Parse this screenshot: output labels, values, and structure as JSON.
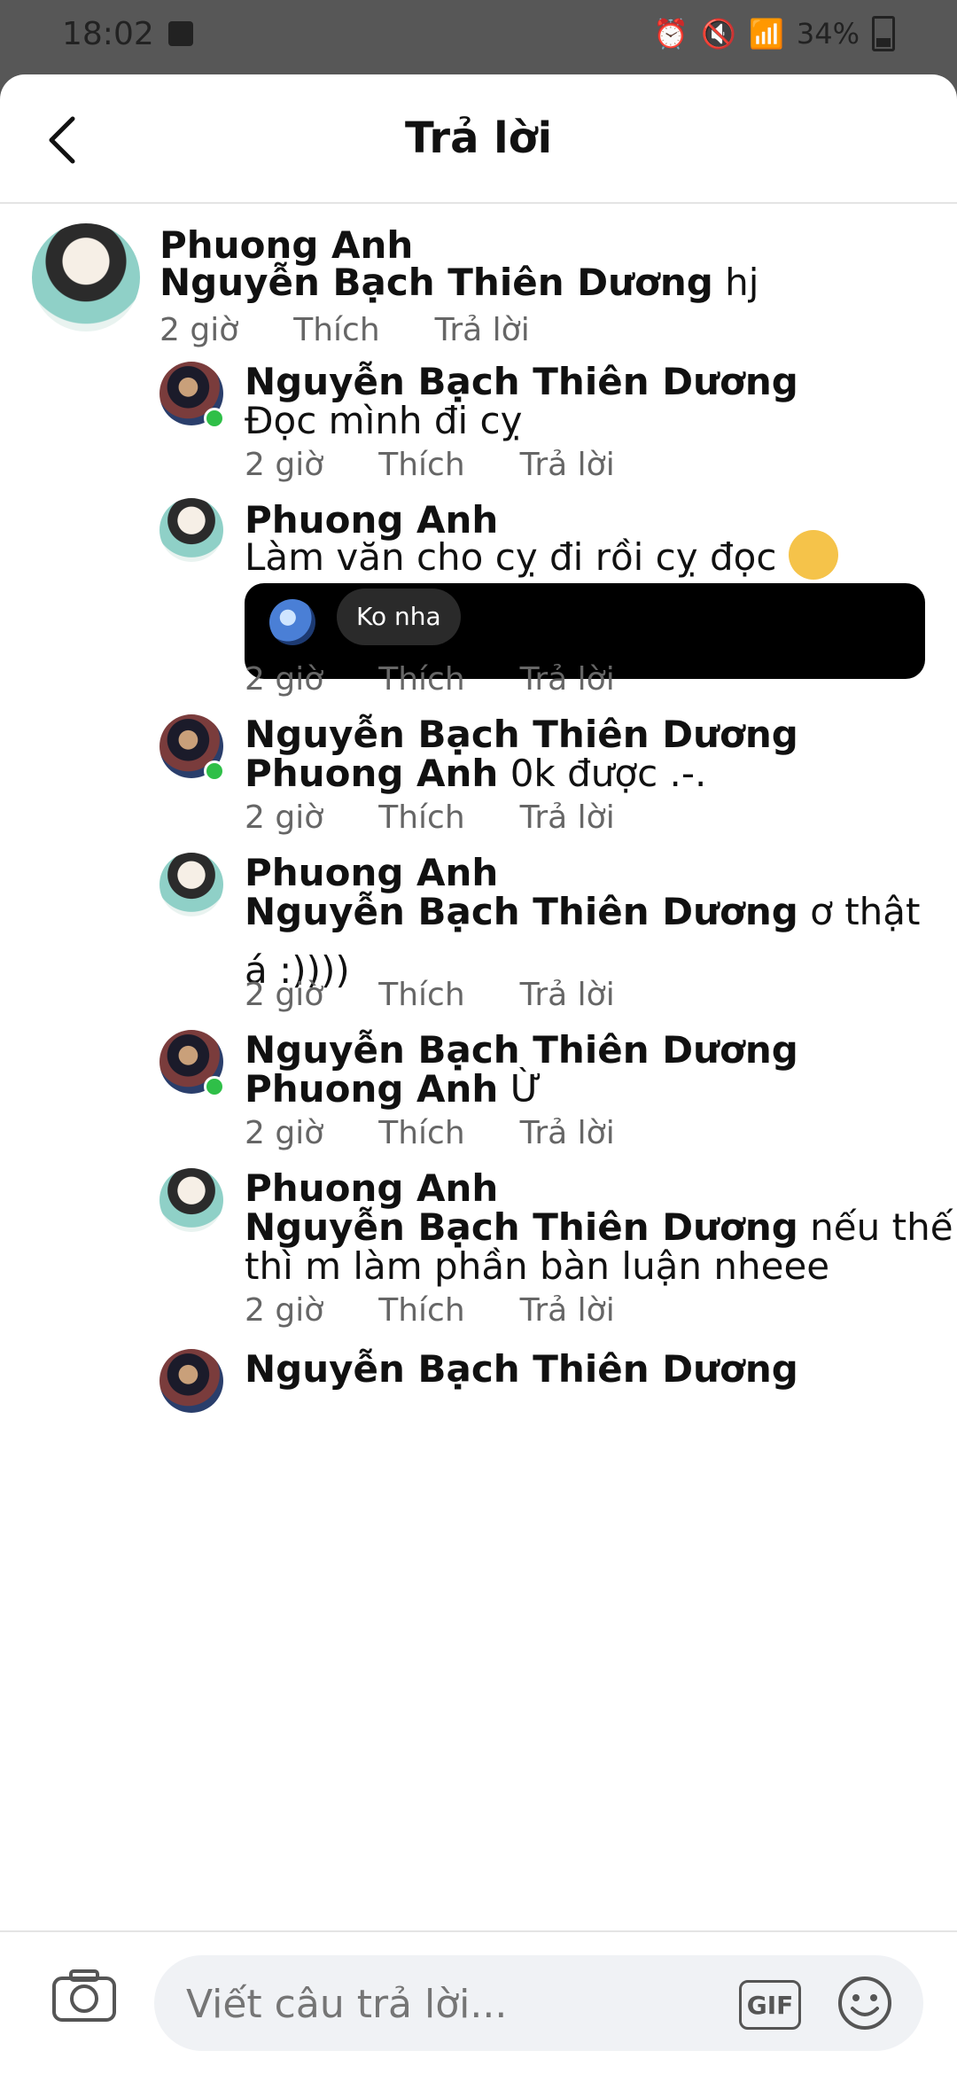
{
  "status": {
    "time": "18:02",
    "battery": "34%"
  },
  "header": {
    "title": "Trả lời"
  },
  "comments": [
    {
      "author": "Phuong Anh",
      "mention": "Nguyễn Bạch Thiên Dương",
      "text": "hj",
      "time": "2 giờ",
      "like": "Thích",
      "reply": "Trả lời"
    },
    {
      "author": "Nguyễn Bạch Thiên Dương",
      "text": "Đọc mình đi cỵ",
      "time": "2 giờ",
      "like": "Thích",
      "reply": "Trả lời"
    },
    {
      "author": "Phuong Anh",
      "text": "Làm văn cho cỵ đi rồi cỵ đọc",
      "story_label": "Ko nha",
      "time": "2 giờ",
      "like": "Thích",
      "reply": "Trả lời"
    },
    {
      "author": "Nguyễn Bạch Thiên Dương",
      "mention": "Phuong Anh",
      "text": "0k được .-.",
      "time": "2 giờ",
      "like": "Thích",
      "reply": "Trả lời"
    },
    {
      "author": "Phuong Anh",
      "mention": "Nguyễn Bạch Thiên Dương",
      "text": "ơ thật",
      "text_line2": "á :))))",
      "time": "2 giờ",
      "like": "Thích",
      "reply": "Trả lời"
    },
    {
      "author": "Nguyễn Bạch Thiên Dương",
      "mention": "Phuong Anh",
      "text": "Ừ",
      "time": "2 giờ",
      "like": "Thích",
      "reply": "Trả lời"
    },
    {
      "author": "Phuong Anh",
      "mention": "Nguyễn Bạch Thiên Dương",
      "text": "nếu thế",
      "text_line2": "thì m làm phần bàn luận nheee",
      "time": "2 giờ",
      "like": "Thích",
      "reply": "Trả lời"
    },
    {
      "author": "Nguyễn Bạch Thiên Dương"
    }
  ],
  "composer": {
    "placeholder": "Viết câu trả lời...",
    "gif_label": "GIF"
  },
  "icons": [
    "alarm-icon",
    "mute-icon",
    "wifi-icon",
    "signal-icon",
    "battery-icon",
    "back-arrow-icon",
    "camera-icon",
    "gif-icon",
    "emoji-icon"
  ]
}
